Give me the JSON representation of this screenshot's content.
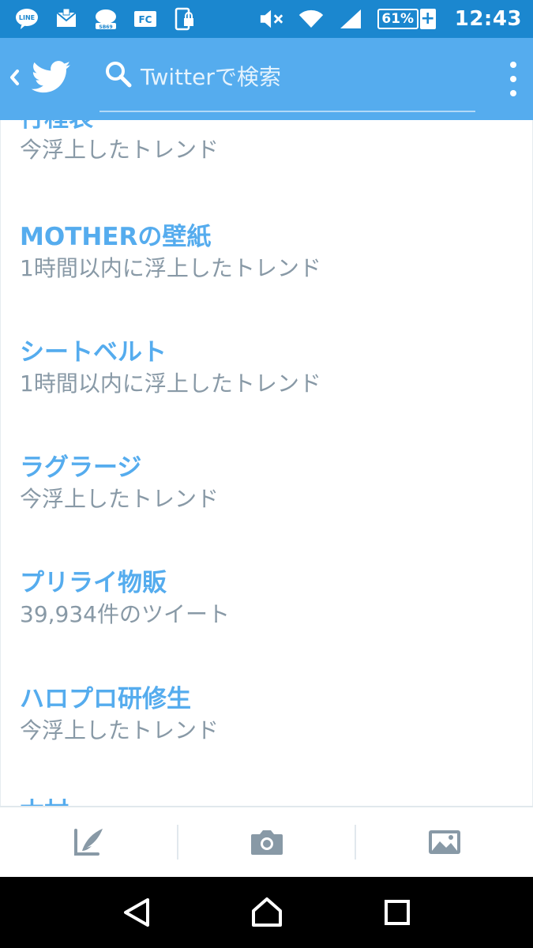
{
  "status_bar": {
    "left_icons": [
      "line-icon",
      "mail-icon",
      "ssb-icon",
      "fc-icon",
      "lock-phone-icon"
    ],
    "battery_percent": "61%",
    "battery_charging": "+",
    "time": "12:43"
  },
  "app_bar": {
    "search_placeholder": "Twitterで検索"
  },
  "trends": [
    {
      "title": "行程表",
      "subtitle": "今浮上したトレンド"
    },
    {
      "title": "MOTHERの壁紙",
      "subtitle": "1時間以内に浮上したトレンド"
    },
    {
      "title": "シートベルト",
      "subtitle": "1時間以内に浮上したトレンド"
    },
    {
      "title": "ラグラージ",
      "subtitle": "今浮上したトレンド"
    },
    {
      "title": "プリライ物販",
      "subtitle": "39,934件のツイート"
    },
    {
      "title": "ハロプロ研修生",
      "subtitle": "今浮上したトレンド"
    },
    {
      "title": "木村",
      "subtitle": ""
    }
  ],
  "colors": {
    "status_bar": "#1b87cf",
    "app_bar": "#55acee",
    "trend_title": "#55acee",
    "trend_subtitle": "#8899a6",
    "toolbar_icon": "#8899a6"
  }
}
